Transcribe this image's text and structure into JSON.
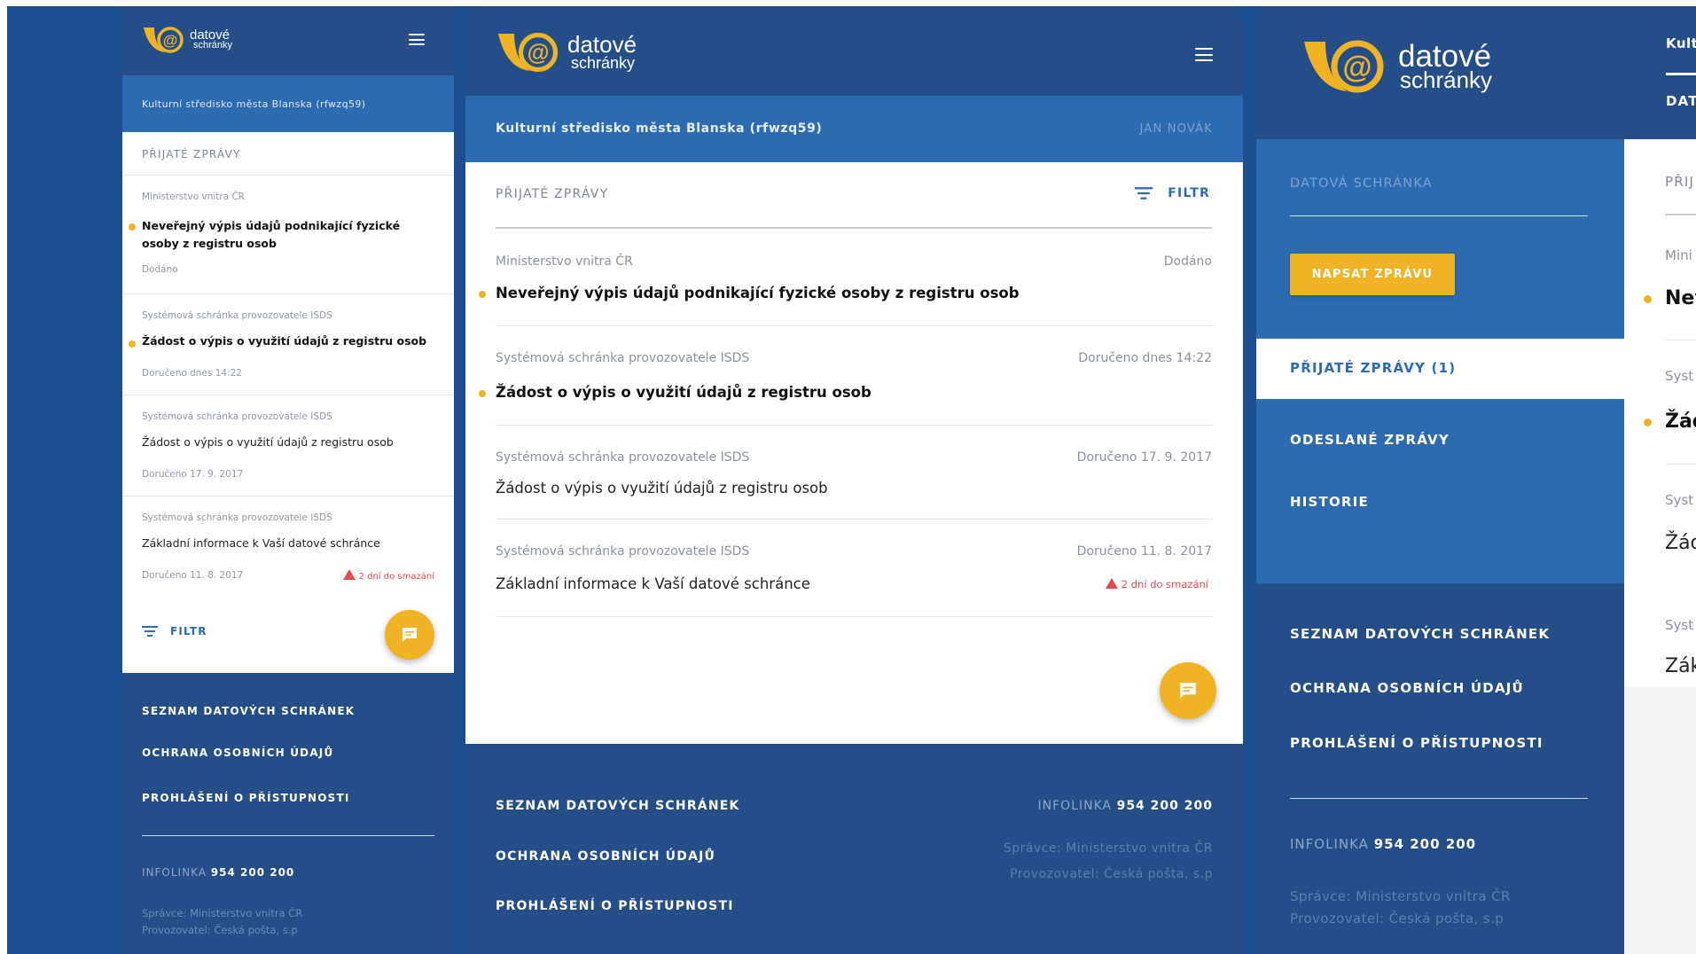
{
  "brand": {
    "line1": "datové",
    "line2": "schránky"
  },
  "colors": {
    "navy": "#244e87",
    "blue": "#2d6bb0",
    "accent": "#f0b323",
    "warning": "#e5484d"
  },
  "org_name": "Kulturní středisko města Blanska (rfwzq59)",
  "user_name": "JAN NOVÁK",
  "section_title": "PŘIJATÉ ZPRÁVY",
  "filter_label": "FILTR",
  "menu_icon": "hamburger-menu-icon",
  "filter_icon": "filter-icon",
  "compose_icon": "chat-bubble-icon",
  "messages": [
    {
      "sender": "Ministerstvo vnitra ČR",
      "subject": "Neveřejný výpis údajů podnikající fyzické osoby z registru osob",
      "status": "Dodáno",
      "unread": true,
      "warning": ""
    },
    {
      "sender": "Systémová schránka provozovatele ISDS",
      "subject": "Žádost o výpis o využití údajů z registru osob",
      "status": "Doručeno dnes 14:22",
      "unread": true,
      "warning": ""
    },
    {
      "sender": "Systémová schránka provozovatele ISDS",
      "subject": "Žádost o výpis o využití údajů z registru osob",
      "status": "Doručeno 17. 9. 2017",
      "unread": false,
      "warning": ""
    },
    {
      "sender": "Systémová schránka provozovatele ISDS",
      "subject": "Základní informace k Vaší datové schránce",
      "status": "Doručeno 11. 8. 2017",
      "unread": false,
      "warning": "2 dní do smazání"
    }
  ],
  "footer": {
    "links": [
      "SEZNAM DATOVÝCH SCHRÁNEK",
      "OCHRANA OSOBNÍCH ÚDAJŮ",
      "PROHLÁŠENÍ O PŘÍSTUPNOSTI"
    ],
    "infoline_label": "INFOLINKA",
    "infoline_number": "954 200 200",
    "admin": "Správce: Ministerstvo vnitra ČR",
    "operator": "Provozovatel: Česká pošta, s.p"
  },
  "sidebar": {
    "box_label": "DATOVÁ SCHRÁNKA",
    "compose_button": "NAPSAT ZPRÁVU",
    "nav": [
      "PŘIJATÉ ZPRÁVY (1)",
      "ODESLANÉ ZPRÁVY",
      "HISTORIE"
    ]
  },
  "desktop_peek": {
    "org": "Kult",
    "tab": "DAT",
    "section": "PŘIJ",
    "rows": [
      {
        "sender": "Mini",
        "subject": "Nev"
      },
      {
        "sender": "Syst",
        "subject": "Žád"
      },
      {
        "sender": "Syst",
        "subject": "Žád"
      },
      {
        "sender": "Syst",
        "subject": "Zák"
      }
    ]
  }
}
